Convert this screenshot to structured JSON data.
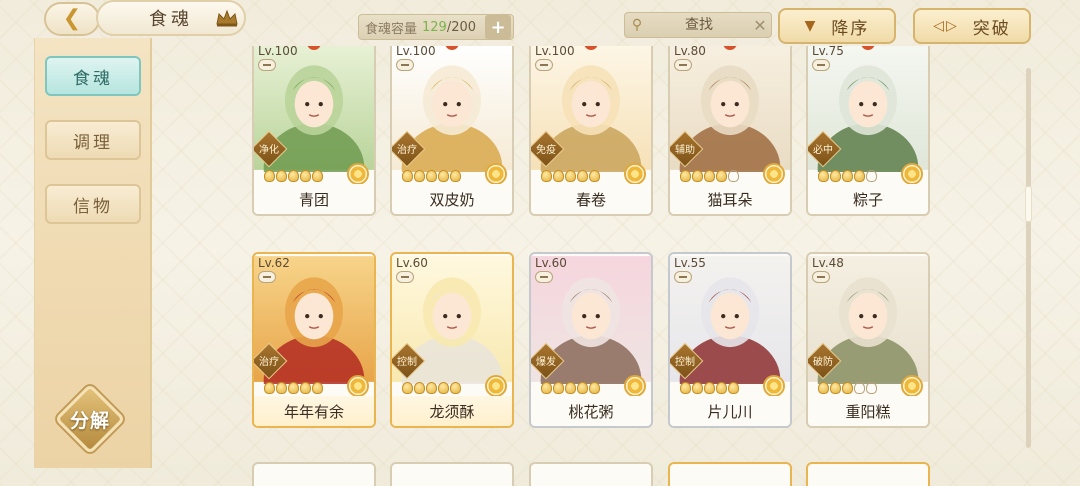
{
  "header": {
    "title": "食魂",
    "capacity_label": "食魂容量",
    "capacity_current": "129",
    "capacity_max": "/200",
    "search_placeholder": "查找",
    "sort_label": "降序",
    "break_label": "突破"
  },
  "sidebar": {
    "items": [
      {
        "label": "食魂",
        "active": true
      },
      {
        "label": "调理",
        "active": false
      },
      {
        "label": "信物",
        "active": false
      }
    ],
    "decompose_label": "分解"
  },
  "cards": [
    {
      "level": "Lv.100",
      "name": "青团",
      "role": "净化",
      "stars": 5,
      "frame": "normal",
      "palette": [
        "#b9d49a",
        "#6f9a4f",
        "#e8f1d6"
      ]
    },
    {
      "level": "Lv.100",
      "name": "双皮奶",
      "role": "治疗",
      "stars": 5,
      "frame": "normal",
      "palette": [
        "#f5ead4",
        "#d8a84b",
        "#ffffff"
      ]
    },
    {
      "level": "Lv.100",
      "name": "春卷",
      "role": "免疫",
      "stars": 5,
      "frame": "normal",
      "palette": [
        "#f6e1b8",
        "#c9a35a",
        "#fdf6e6"
      ]
    },
    {
      "level": "Lv.80",
      "name": "猫耳朵",
      "role": "辅助",
      "stars": 4,
      "frame": "normal",
      "palette": [
        "#e9dcc4",
        "#9d6b3e",
        "#f7efe0"
      ]
    },
    {
      "level": "Lv.75",
      "name": "粽子",
      "role": "必中",
      "stars": 4,
      "frame": "normal",
      "palette": [
        "#dfe6d8",
        "#5d7e4a",
        "#f5f7f1"
      ]
    },
    {
      "level": "Lv.62",
      "name": "年年有余",
      "role": "治疗",
      "stars": 5,
      "frame": "gold",
      "palette": [
        "#e8a54a",
        "#b32a22",
        "#f7d48a"
      ]
    },
    {
      "level": "Lv.60",
      "name": "龙须酥",
      "role": "控制",
      "stars": 5,
      "frame": "gold",
      "palette": [
        "#f8e9b0",
        "#e9e4dc",
        "#fff8df"
      ]
    },
    {
      "level": "Lv.60",
      "name": "桃花粥",
      "role": "爆发",
      "stars": 5,
      "frame": "silver",
      "palette": [
        "#efe4e2",
        "#8a6a58",
        "#f6d6de"
      ]
    },
    {
      "level": "Lv.55",
      "name": "片儿川",
      "role": "控制",
      "stars": 5,
      "frame": "silver",
      "palette": [
        "#e6e6ea",
        "#8d2f2f",
        "#f4f2ef"
      ]
    },
    {
      "level": "Lv.48",
      "name": "重阳糕",
      "role": "破防",
      "stars": 3,
      "frame": "normal",
      "palette": [
        "#e9e1cf",
        "#8a8f63",
        "#f4efe2"
      ]
    }
  ]
}
